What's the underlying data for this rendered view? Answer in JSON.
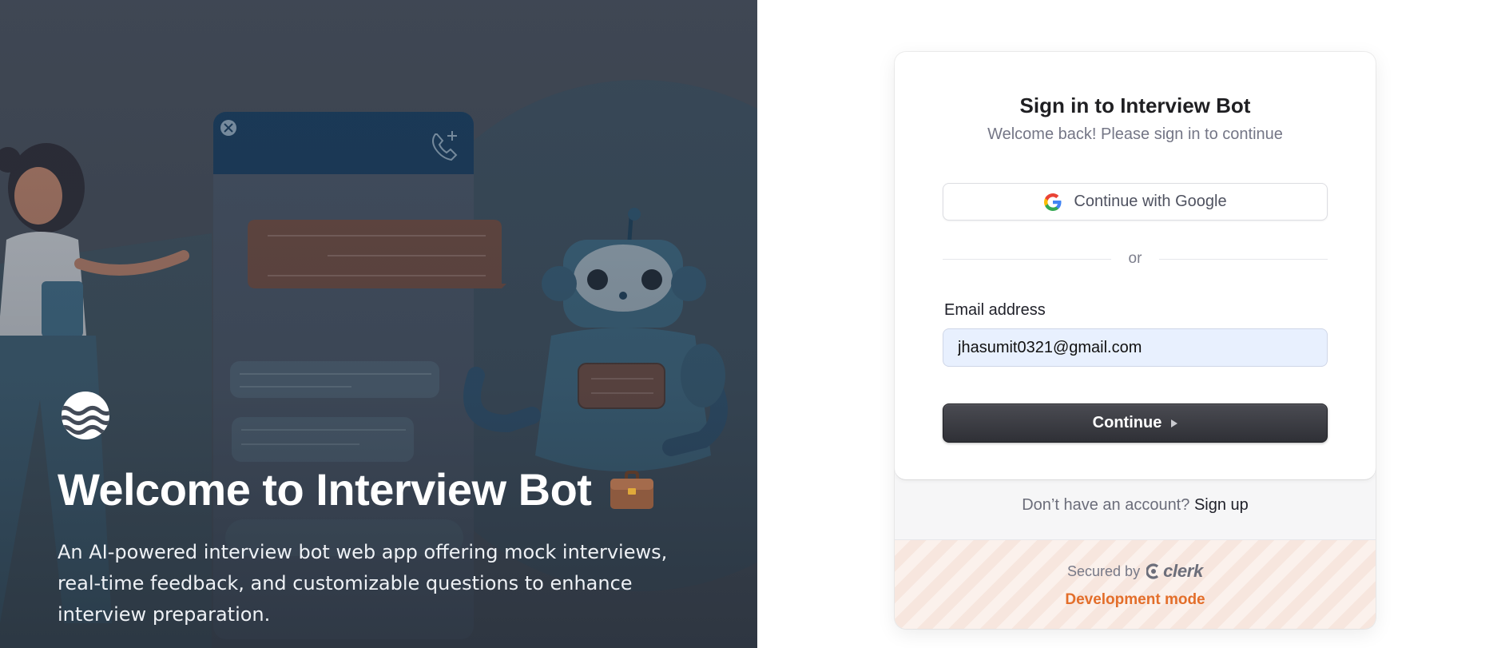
{
  "hero": {
    "title": "Welcome to Interview Bot",
    "description": "An AI-powered interview bot web app offering mock interviews, real-time feedback, and customizable questions to enhance interview preparation.",
    "logo_icon": "waves-logo-icon",
    "title_icon": "briefcase-icon"
  },
  "signin": {
    "title": "Sign in to Interview Bot",
    "subtitle": "Welcome back! Please sign in to continue",
    "google_label": "Continue with Google",
    "divider_text": "or",
    "email_label": "Email address",
    "email_value": "jhasumit0321@gmail.com",
    "continue_label": "Continue",
    "no_account_text": "Don’t have an account?",
    "signup_label": "Sign up",
    "secured_by": "Secured by",
    "clerk_brand": "clerk",
    "dev_mode": "Development mode"
  },
  "colors": {
    "hero_bg": "#434b58",
    "primary_button": "#2f3036",
    "dev_mode": "#e36e2a",
    "input_autofill": "#e8f0fe"
  }
}
